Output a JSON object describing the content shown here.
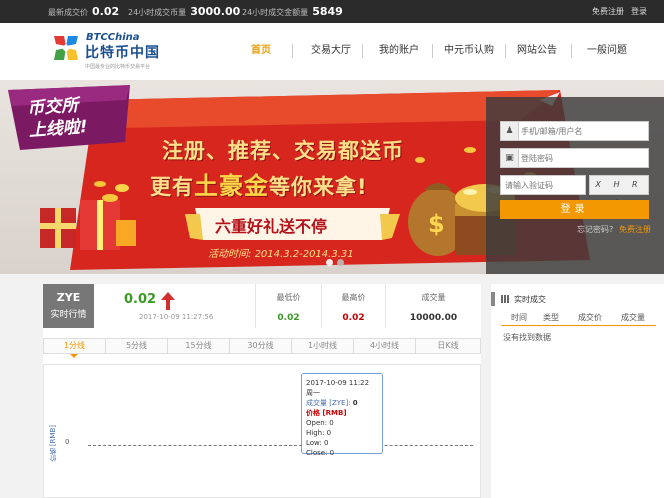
{
  "topbar": {
    "latest_price_label": "最新成交价",
    "latest_price_value": "0.02",
    "volume_24h_label": "24小时成交币量",
    "volume_24h_value": "3000.00",
    "amount_24h_label": "24小时成交金额量",
    "amount_24h_value": "5849",
    "register_link": "免费注册",
    "login_link": "登录"
  },
  "header": {
    "logo_en": "BTCChina",
    "logo_cn": "比特币中国",
    "logo_tagline": "中国最专业的比特币交易平台",
    "nav": [
      "首页",
      "交易大厅",
      "我的账户",
      "中元币认购",
      "网站公告",
      "一般问题"
    ]
  },
  "banner": {
    "badge_line1": "币交所",
    "badge_line2": "上线啦!",
    "headline1": "注册、推荐、交易都送币",
    "headline2_pre": "更有",
    "headline2_big": "土豪金",
    "headline2_post": "等你来拿!",
    "ribbon": "六重好礼送不停",
    "period_label": "活动时间:",
    "period_value": "2014.3.2-2014.3.31"
  },
  "login": {
    "user_placeholder": "手机/邮箱/用户名",
    "password_placeholder": "登陆密码",
    "captcha_placeholder": "请输入验证码",
    "captcha_text": "X H R 0",
    "submit_label": "登录",
    "forgot_label": "忘记密码?",
    "register_label": "免费注册"
  },
  "market": {
    "symbol": "ZYE",
    "subtitle": "实时行情",
    "price": "0.02",
    "time": "2017-10-09 11:27:56",
    "low_label": "最低价",
    "low_value": "0.02",
    "high_label": "最高价",
    "high_value": "0.02",
    "volume_label": "成交量",
    "volume_value": "10000.00",
    "tabs": [
      "1分线",
      "5分线",
      "15分线",
      "30分线",
      "1小时线",
      "4小时线",
      "日K线"
    ],
    "chart_ylabel": "价格 [RMB]",
    "chart_ytick": "0",
    "tooltip": {
      "line1": "2017-10-09 11:22 周一",
      "vol_label": "成交量 [ZYE]:",
      "vol_value": "0",
      "price_label": "价格 [RMB]",
      "open": "Open: 0",
      "high": "High: 0",
      "low": "Low: 0",
      "close": "Close: 0"
    }
  },
  "realtime": {
    "title": "实时成交",
    "columns": [
      "时间",
      "类型",
      "成交价",
      "成交量"
    ],
    "empty": "没有找到数据"
  },
  "colors": {
    "accent": "#f39800",
    "price_green": "#3a9a25",
    "price_red": "#c00000"
  }
}
